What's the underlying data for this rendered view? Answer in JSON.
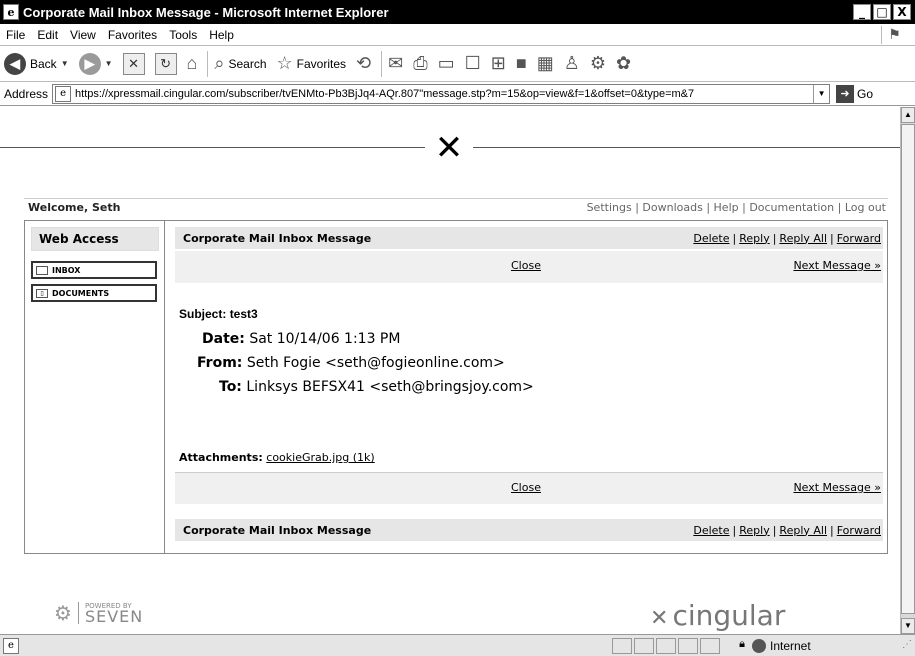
{
  "window": {
    "title": "Corporate Mail Inbox Message - Microsoft Internet Explorer",
    "controls": {
      "minimize": "_",
      "maximize": "□",
      "close": "X"
    }
  },
  "menu": {
    "items": [
      {
        "label": "File"
      },
      {
        "label": "Edit"
      },
      {
        "label": "View"
      },
      {
        "label": "Favorites"
      },
      {
        "label": "Tools"
      },
      {
        "label": "Help"
      }
    ]
  },
  "toolbar": {
    "back_label": "Back",
    "search_label": "Search",
    "favorites_label": "Favorites"
  },
  "address": {
    "label": "Address",
    "url": "https://xpressmail.cingular.com/subscriber/tvENMto-Pb3BjJq4-AQr.807\"message.stp?m=15&op=view&f=1&offset=0&type=m&7",
    "go_label": "Go"
  },
  "page": {
    "welcome": "Welcome, Seth",
    "top_links": [
      "Settings",
      "Downloads",
      "Help",
      "Documentation",
      "Log out"
    ],
    "sidebar": {
      "heading": "Web Access",
      "items": [
        {
          "label": "INBOX"
        },
        {
          "label": "DOCUMENTS"
        }
      ]
    },
    "message_bar": {
      "title": "Corporate Mail Inbox Message",
      "actions": [
        "Delete",
        "Reply",
        "Reply All",
        "Forward"
      ]
    },
    "nav": {
      "close_label": "Close",
      "next_label": "Next Message »"
    },
    "message": {
      "subject_label": "Subject:",
      "subject": "test3",
      "date_label": "Date:",
      "date": "Sat 10/14/06 1:13 PM",
      "from_label": "From:",
      "from": "Seth Fogie <seth@fogieonline.com>",
      "to_label": "To:",
      "to": "Linksys BEFSX41 <seth@bringsjoy.com>",
      "attachments_label": "Attachments:",
      "attachment": "cookieGrab.jpg (1k)"
    },
    "footer": {
      "powered_by": "POWERED BY",
      "seven": "SEVEN",
      "cingular": "cingular"
    }
  },
  "status": {
    "zone": "Internet"
  }
}
